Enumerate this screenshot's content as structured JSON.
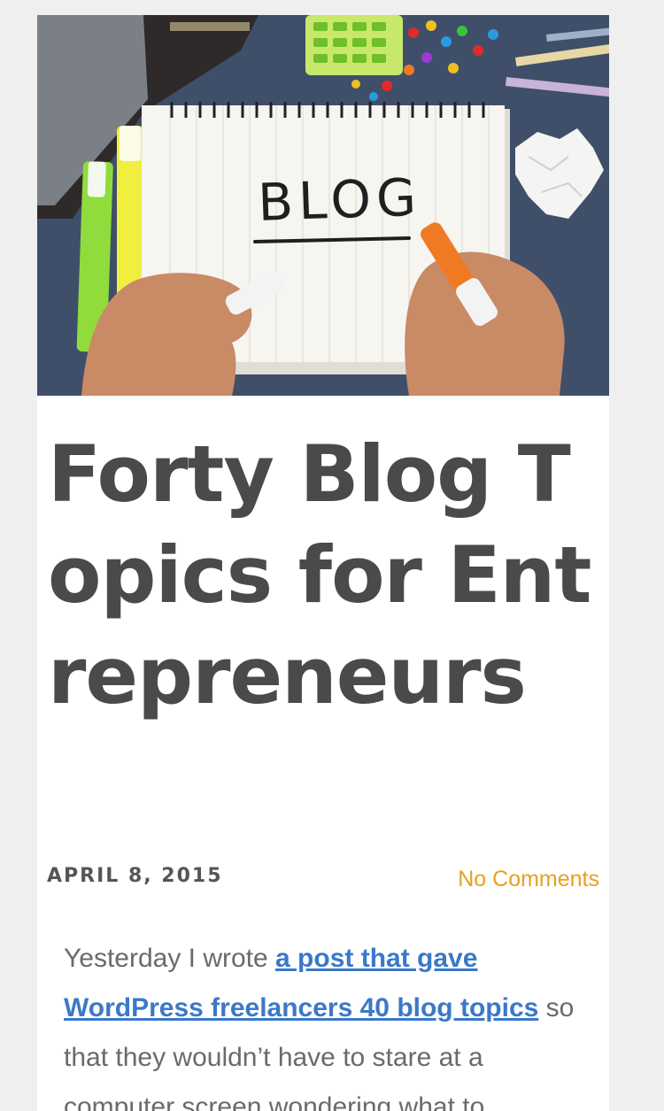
{
  "hero": {
    "image_alt": "Hand writing BLOG on a spiral notepad",
    "notepad_text": "BLOG",
    "colors": {
      "desk": "#3f4f6a",
      "paper": "#f7f5f0",
      "marker_orange": "#f07a24",
      "highlighter_green": "#8fdc3c",
      "highlighter_yellow": "#f0ef40",
      "calculator": "#c7e86a"
    }
  },
  "post": {
    "title": "Forty Blog Topics for Entrepreneurs",
    "date": "APRIL 8, 2015",
    "comments": "No Comments",
    "excerpt_before": "Yesterday I wrote ",
    "excerpt_link": "a post that gave WordPress freelancers 40 blog topics",
    "excerpt_after": " so that they wouldn’t have to stare at a computer screen wondering what to"
  },
  "colors": {
    "page_bg": "#efefef",
    "card_bg": "#ffffff",
    "title": "#4a4a4a",
    "date": "#555555",
    "comments_link": "#e8a020",
    "body_text": "#6a6a6a",
    "link": "#3b78c7"
  }
}
